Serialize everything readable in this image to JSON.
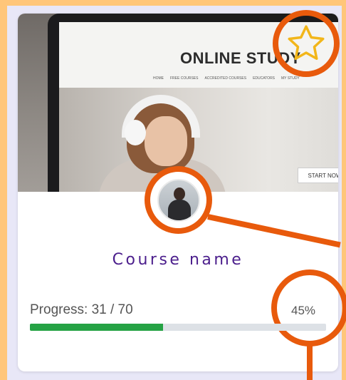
{
  "course": {
    "name": "Course name",
    "progress_label": "Progress: 31 / 70",
    "progress_percent_text": "45%",
    "progress_fraction": 0.45
  },
  "thumbnail": {
    "site_title": "ONLINE STUDY",
    "nav": [
      "HOME",
      "FREE COURSES",
      "ACCREDITED COURSES",
      "EDUCATORS",
      "MY STUDY"
    ],
    "cta": "START NOW"
  },
  "icons": {
    "favorite": "star-outline-icon",
    "avatar": "instructor-avatar"
  },
  "colors": {
    "highlight": "#e85a0c",
    "course_name": "#4b1e8c",
    "progress_fill": "#25a244",
    "progress_track": "#dde1e6",
    "star": "#f2b61a",
    "page_bg": "#ffc67a"
  }
}
